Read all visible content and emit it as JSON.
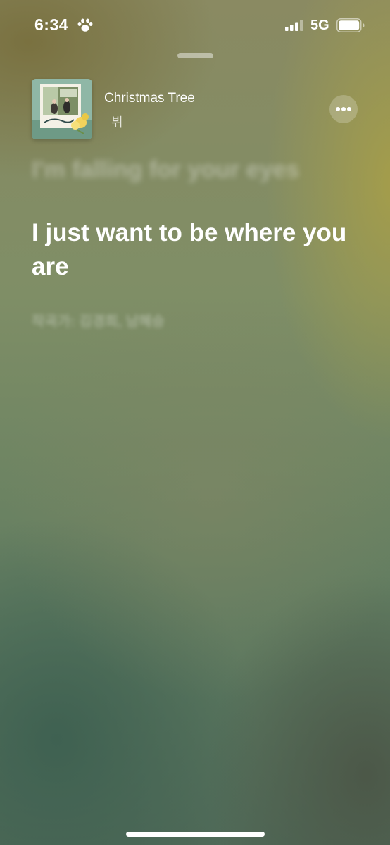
{
  "status_bar": {
    "time": "6:34",
    "network": "5G",
    "icons": [
      "paw-icon",
      "signal-icon",
      "battery-icon"
    ]
  },
  "now_playing": {
    "title": "Christmas Tree",
    "artist": "뷔",
    "more_icon": "ellipsis-icon"
  },
  "lyrics": {
    "previous_line": "I'm falling for your eyes",
    "current_line": "I just want to be where you are",
    "credits": "작곡가: 김경희, 남혜승"
  },
  "colors": {
    "text": "#ffffff",
    "background_top": "#8a8a62",
    "background_bottom": "#506a58"
  }
}
